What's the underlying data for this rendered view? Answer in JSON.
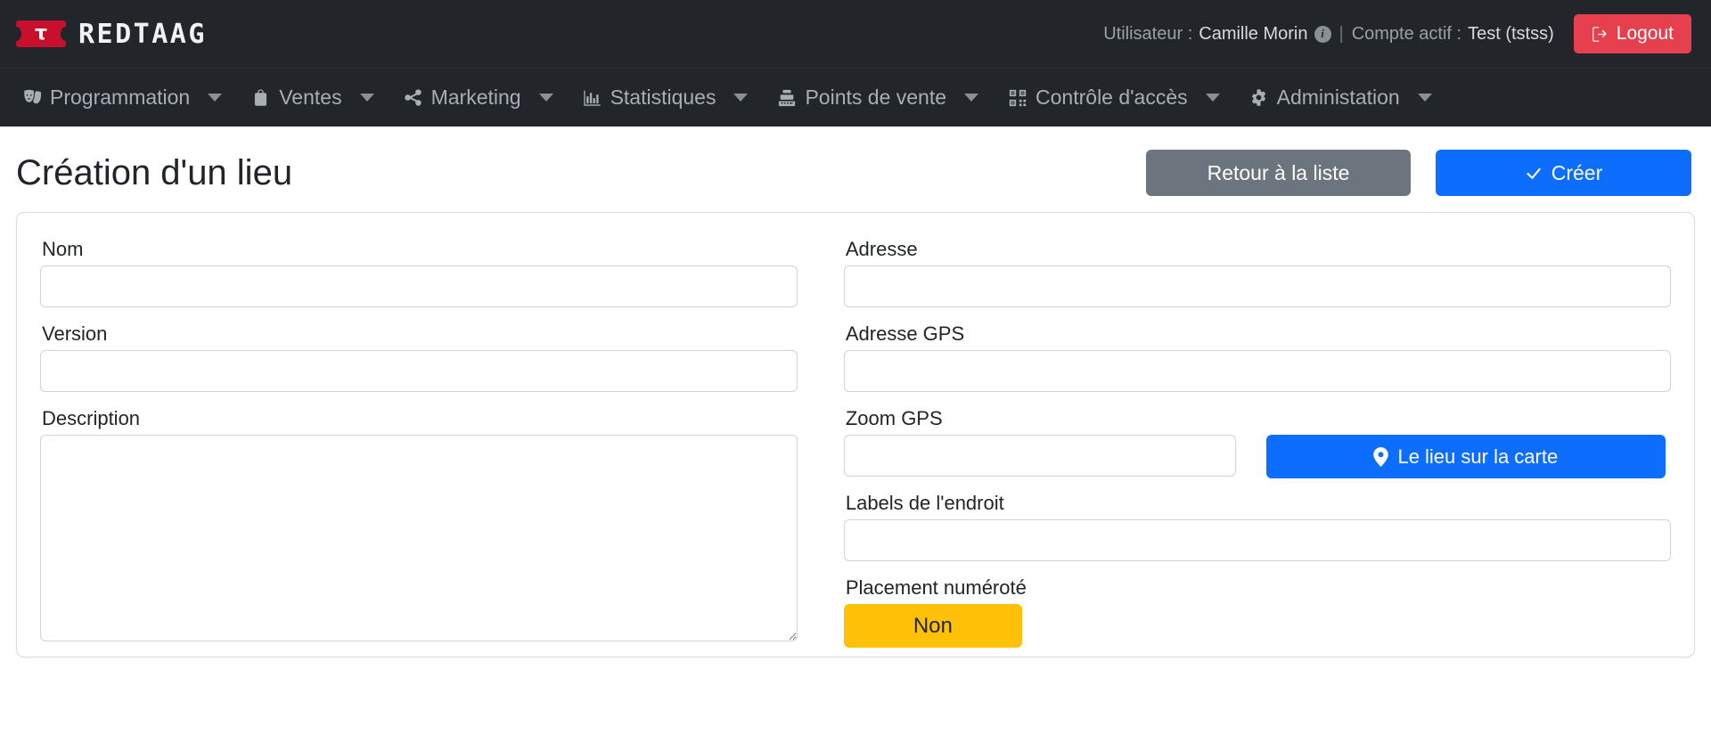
{
  "brand": {
    "name": "REDTAAG",
    "ticket_glyph": "τ",
    "accent_red": "#c8102e"
  },
  "topbar": {
    "user_label": "Utilisateur :",
    "user_name": "Camille Morin",
    "info_icon": "info-icon",
    "separator": "|",
    "account_label": "Compte actif :",
    "account_name": "Test (tstss)",
    "logout_label": "Logout",
    "logout_color": "#e6404f"
  },
  "nav": {
    "items": [
      {
        "label": "Programmation",
        "icon": "theater-masks-icon",
        "has_caret": true
      },
      {
        "label": "Ventes",
        "icon": "shopping-bag-icon",
        "has_caret": true
      },
      {
        "label": "Marketing",
        "icon": "share-nodes-icon",
        "has_caret": true
      },
      {
        "label": "Statistiques",
        "icon": "bar-chart-icon",
        "has_caret": true
      },
      {
        "label": "Points de vente",
        "icon": "cash-register-icon",
        "has_caret": true
      },
      {
        "label": "Contrôle d'accès",
        "icon": "qr-code-icon",
        "has_caret": true
      },
      {
        "label": "Administation",
        "icon": "gear-icon",
        "has_caret": true
      }
    ]
  },
  "page": {
    "title": "Création d'un lieu",
    "back_button": "Retour à la liste",
    "create_button": "Créer",
    "create_color": "#0d6efd",
    "back_color": "#6c757d"
  },
  "form": {
    "left": {
      "nom_label": "Nom",
      "nom_value": "",
      "nom_placeholder": "",
      "version_label": "Version",
      "version_value": "",
      "version_placeholder": "",
      "description_label": "Description",
      "description_value": "",
      "description_placeholder": ""
    },
    "right": {
      "adresse_label": "Adresse",
      "adresse_value": "",
      "adresse_placeholder": "",
      "adresse_gps_label": "Adresse GPS",
      "adresse_gps_value": "",
      "adresse_gps_placeholder": "",
      "zoom_gps_label": "Zoom GPS",
      "zoom_gps_value": "",
      "zoom_gps_placeholder": "",
      "map_button_label": "Le lieu sur la carte",
      "map_button_icon": "map-pin-icon",
      "labels_endroit_label": "Labels de l'endroit",
      "labels_endroit_value": "",
      "labels_endroit_placeholder": "",
      "placement_label": "Placement numéroté",
      "placement_value": "Non",
      "placement_color": "#ffc107"
    }
  }
}
